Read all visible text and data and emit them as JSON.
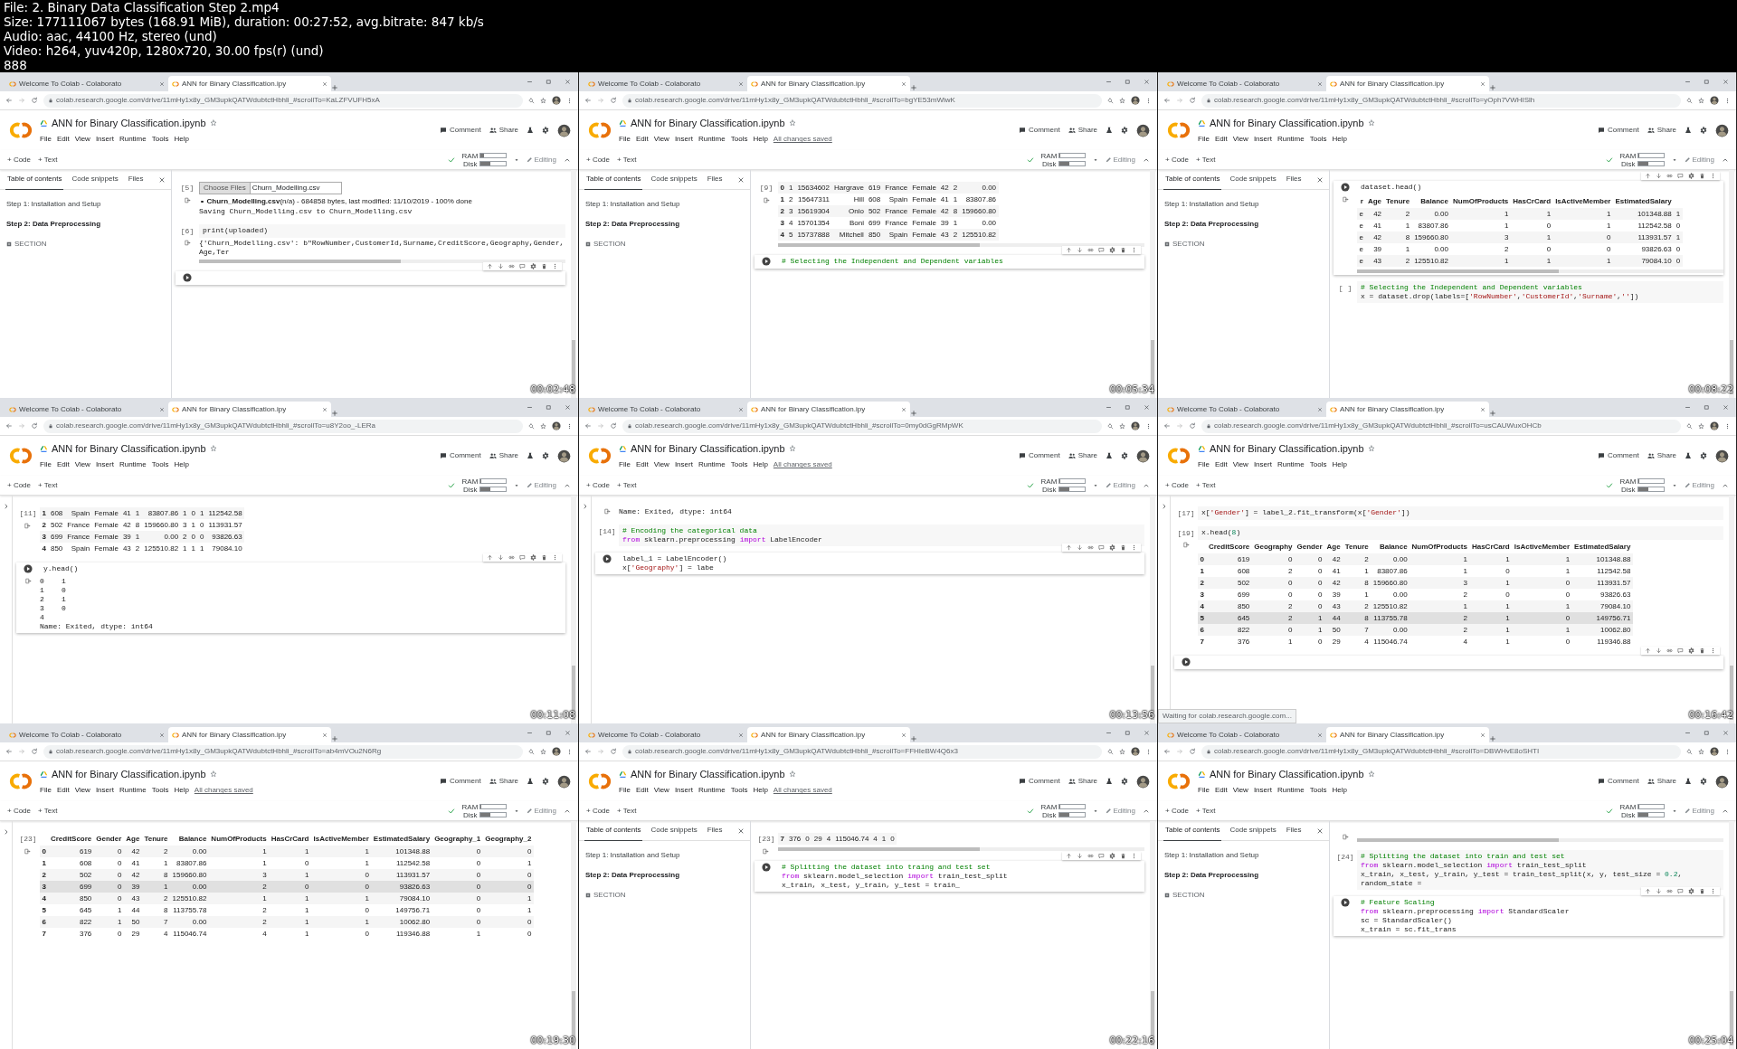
{
  "file_info": [
    "File: 2. Binary Data Classification Step 2.mp4",
    "Size: 177111067 bytes (168.91 MiB), duration: 00:27:52, avg.bitrate: 847 kb/s",
    "Audio: aac, 44100 Hz, stereo (und)",
    "Video: h264, yuv420p, 1280x720, 30.00 fps(r) (und)",
    "888"
  ],
  "frames": [
    {
      "timestamp": "00:02:48",
      "tabs": [
        {
          "title": "Welcome To Colab - Colaborato",
          "selected": false
        },
        {
          "title": "ANN for Binary Classification.ipy",
          "selected": true
        }
      ],
      "url": "colab.research.google.com/drive/11mHy1x8y_GM3upkQATWdubtctHbhli_#scrollTo=KaLZFVUFH5xA",
      "notebook_title": "ANN for Binary Classification.ipynb",
      "menu": [
        "File",
        "Edit",
        "View",
        "Insert",
        "Runtime",
        "Tools",
        "Help"
      ],
      "actions": [
        "Comment",
        "Share"
      ],
      "insert": [
        "+ Code",
        "+ Text"
      ],
      "meters": [
        {
          "label": "RAM",
          "level": 0.15
        },
        {
          "label": "Disk",
          "level": 0.4
        }
      ],
      "mode": "Editing",
      "sidebar": {
        "tabs": [
          {
            "label": "Table of contents",
            "selected": true
          },
          {
            "label": "Code snippets",
            "selected": false
          },
          {
            "label": "Files",
            "selected": false
          }
        ],
        "items": [
          {
            "text": "Step 1: Installation and Setup",
            "selected": false
          },
          {
            "text": "Step 2: Data Preprocessing",
            "selected": true
          }
        ],
        "add_section": "SECTION"
      },
      "cells": [
        {
          "prompt": "[5]",
          "active": false,
          "outputs": [
            {
              "kind": "upload",
              "button": "Choose Files",
              "file": "Churn_Modelling.csv",
              "status": "**Churn_Modelling.csv**(n/a) - 684858 bytes, last modified: 11/10/2019 - 100% done",
              "log": "Saving Churn_Modelling.csv to Churn_Modelling.csv"
            }
          ]
        },
        {
          "prompt": "[6]",
          "active": false,
          "code": [
            "print(uploaded)"
          ],
          "outputs": [
            {
              "kind": "text",
              "lines": [
                "{'Churn_Modelling.csv': b\"RowNumber,CustomerId,Surname,CreditScore,Geography,Gender,Age,Ter"
              ],
              "scrollbar": true
            }
          ]
        },
        {
          "active": true
        }
      ]
    },
    {
      "timestamp": "00:05:34",
      "tabs": [
        {
          "title": "Welcome To Colab - Colaborato",
          "selected": false
        },
        {
          "title": "ANN for Binary Classification.ipy",
          "selected": true
        }
      ],
      "url": "colab.research.google.com/drive/11mHy1x8y_GM3upkQATWdubtctHbhli_#scrollTo=bgYE53mWiwK",
      "notebook_title": "ANN for Binary Classification.ipynb",
      "menu": [
        "File",
        "Edit",
        "View",
        "Insert",
        "Runtime",
        "Tools",
        "Help"
      ],
      "save_status": "All changes saved",
      "actions": [
        "Comment",
        "Share"
      ],
      "insert": [
        "+ Code",
        "+ Text"
      ],
      "meters": [
        {
          "label": "RAM",
          "level": 0.05
        },
        {
          "label": "Disk",
          "level": 0.4
        }
      ],
      "mode": "Editing",
      "sidebar": {
        "tabs": [
          {
            "label": "Table of contents",
            "selected": true
          },
          {
            "label": "Code snippets",
            "selected": false
          },
          {
            "label": "Files",
            "selected": false
          }
        ],
        "items": [
          {
            "text": "Step 1: Installation and Setup",
            "selected": false
          },
          {
            "text": "Step 2: Data Preprocessing",
            "selected": true
          }
        ],
        "add_section": "SECTION"
      },
      "cells": [
        {
          "prompt": "[9]",
          "active": false,
          "outputs": [
            {
              "kind": "table",
              "scrollbar": true,
              "rows": [
                {
                  "index": "0",
                  "cells": [
                    "1",
                    "15634602",
                    "Hargrave",
                    "619",
                    "France",
                    "Female",
                    "42",
                    "2",
                    "0.00"
                  ]
                },
                {
                  "index": "1",
                  "cells": [
                    "2",
                    "15647311",
                    "Hill",
                    "608",
                    "Spain",
                    "Female",
                    "41",
                    "1",
                    "83807.86"
                  ]
                },
                {
                  "index": "2",
                  "cells": [
                    "3",
                    "15619304",
                    "Onio",
                    "502",
                    "France",
                    "Female",
                    "42",
                    "8",
                    "159660.80"
                  ]
                },
                {
                  "index": "3",
                  "cells": [
                    "4",
                    "15701354",
                    "Boni",
                    "699",
                    "France",
                    "Female",
                    "39",
                    "1",
                    "0.00"
                  ]
                },
                {
                  "index": "4",
                  "cells": [
                    "5",
                    "15737888",
                    "Mitchell",
                    "850",
                    "Spain",
                    "Female",
                    "43",
                    "2",
                    "125510.82"
                  ]
                }
              ]
            }
          ]
        },
        {
          "active": true,
          "code": [
            [
              {
                "text": "# Selecting the Independent and Dependent variables",
                "kind": "comment"
              }
            ]
          ]
        }
      ]
    },
    {
      "timestamp": "00:08:22",
      "tabs": [
        {
          "title": "Welcome To Colab - Colaborato",
          "selected": false
        },
        {
          "title": "ANN for Binary Classification.ipy",
          "selected": true
        }
      ],
      "url": "colab.research.google.com/drive/11mHy1x8y_GM3upkQATWdubtctHbhli_#scrollTo=yOph7VWHISlh",
      "notebook_title": "ANN for Binary Classification.ipynb",
      "menu": [
        "File",
        "Edit",
        "View",
        "Insert",
        "Runtime",
        "Tools",
        "Help"
      ],
      "actions": [
        "Comment",
        "Share"
      ],
      "insert": [
        "+ Code",
        "+ Text"
      ],
      "meters": [
        {
          "label": "RAM",
          "level": 0.05
        },
        {
          "label": "Disk",
          "level": 0.4
        }
      ],
      "mode": "Editing",
      "sidebar": {
        "tabs": [
          {
            "label": "Table of contents",
            "selected": true
          },
          {
            "label": "Code snippets",
            "selected": false
          },
          {
            "label": "Files",
            "selected": false
          }
        ],
        "items": [
          {
            "text": "Step 1: Installation and Setup",
            "selected": false
          },
          {
            "text": "Step 2: Data Preprocessing",
            "selected": true
          }
        ],
        "add_section": "SECTION"
      },
      "cells": [
        {
          "active": true,
          "code": [
            "dataset.head()"
          ],
          "outputs": [
            {
              "kind": "table",
              "scrollbar": true,
              "columns": [
                "r",
                "Age",
                "Tenure",
                "Balance",
                "NumOfProducts",
                "HasCrCard",
                "IsActiveMember",
                "EstimatedSalary"
              ],
              "rows": [
                {
                  "cells": [
                    "e",
                    "42",
                    "2",
                    "0.00",
                    "1",
                    "1",
                    "1",
                    "101348.88",
                    "1"
                  ]
                },
                {
                  "cells": [
                    "e",
                    "41",
                    "1",
                    "83807.86",
                    "1",
                    "0",
                    "1",
                    "112542.58",
                    "0"
                  ]
                },
                {
                  "cells": [
                    "e",
                    "42",
                    "8",
                    "159660.80",
                    "3",
                    "1",
                    "0",
                    "113931.57",
                    "1"
                  ]
                },
                {
                  "cells": [
                    "e",
                    "39",
                    "1",
                    "0.00",
                    "2",
                    "0",
                    "0",
                    "93826.63",
                    "0"
                  ]
                },
                {
                  "cells": [
                    "e",
                    "43",
                    "2",
                    "125510.82",
                    "1",
                    "1",
                    "1",
                    "79084.10",
                    "0"
                  ]
                }
              ]
            }
          ]
        },
        {
          "prompt": "[ ]",
          "active": false,
          "code": [
            [
              {
                "text": "# Selecting the Independent and Dependent variables",
                "kind": "comment"
              }
            ],
            [
              {
                "text": "x = dataset.drop(labels=[",
                "kind": "plain"
              },
              {
                "text": "'RowNumber'",
                "kind": "string"
              },
              {
                "text": ",",
                "kind": "plain"
              },
              {
                "text": "'CustomerId'",
                "kind": "string"
              },
              {
                "text": ",",
                "kind": "plain"
              },
              {
                "text": "'Surname'",
                "kind": "string"
              },
              {
                "text": ",",
                "kind": "plain"
              },
              {
                "text": "''",
                "kind": "string"
              },
              {
                "text": "])",
                "kind": "plain"
              }
            ]
          ]
        }
      ]
    },
    {
      "timestamp": "00:11:08",
      "tabs": [
        {
          "title": "Welcome To Colab - Colaborato",
          "selected": false
        },
        {
          "title": "ANN for Binary Classification.ipy",
          "selected": true
        }
      ],
      "url": "colab.research.google.com/drive/11mHy1x8y_GM3upkQATWdubtctHbhli_#scrollTo=u8Y2oo_-LERa",
      "notebook_title": "ANN for Binary Classification.ipynb",
      "menu": [
        "File",
        "Edit",
        "View",
        "Insert",
        "Runtime",
        "Tools",
        "Help"
      ],
      "actions": [
        "Comment",
        "Share"
      ],
      "insert": [
        "+ Code",
        "+ Text"
      ],
      "meters": [
        {
          "label": "RAM",
          "level": 0.05
        },
        {
          "label": "Disk",
          "level": 0.4
        }
      ],
      "mode": "Editing",
      "cells": [
        {
          "prompt": "[11]",
          "active": false,
          "outputs": [
            {
              "kind": "table",
              "rows": [
                {
                  "index": "1",
                  "cells": [
                    "608",
                    "Spain",
                    "Female",
                    "41",
                    "1",
                    "83807.86",
                    "1",
                    "0",
                    "1",
                    "112542.58"
                  ]
                },
                {
                  "index": "2",
                  "cells": [
                    "502",
                    "France",
                    "Female",
                    "42",
                    "8",
                    "159660.80",
                    "3",
                    "1",
                    "0",
                    "113931.57"
                  ]
                },
                {
                  "index": "3",
                  "cells": [
                    "699",
                    "France",
                    "Female",
                    "39",
                    "1",
                    "0.00",
                    "2",
                    "0",
                    "0",
                    "93826.63"
                  ]
                },
                {
                  "index": "4",
                  "cells": [
                    "850",
                    "Spain",
                    "Female",
                    "43",
                    "2",
                    "125510.82",
                    "1",
                    "1",
                    "1",
                    "79084.10"
                  ]
                }
              ]
            }
          ]
        },
        {
          "active": true,
          "code": [
            "y.head()"
          ],
          "outputs": [
            {
              "kind": "text",
              "lines": [
                "0    1",
                "1    0",
                "2    1",
                "3    0",
                "4",
                "Name: Exited, dtype: int64"
              ]
            }
          ]
        }
      ]
    },
    {
      "timestamp": "00:13:56",
      "tabs": [
        {
          "title": "Welcome To Colab - Colaborato",
          "selected": false
        },
        {
          "title": "ANN for Binary Classification.ipy",
          "selected": true
        }
      ],
      "url": "colab.research.google.com/drive/11mHy1x8y_GM3upkQATWdubtctHbhli_#scrollTo=0my0dGgRMpWK",
      "notebook_title": "ANN for Binary Classification.ipynb",
      "menu": [
        "File",
        "Edit",
        "View",
        "Insert",
        "Runtime",
        "Tools",
        "Help"
      ],
      "save_status": "All changes saved",
      "actions": [
        "Comment",
        "Share"
      ],
      "insert": [
        "+ Code",
        "+ Text"
      ],
      "meters": [
        {
          "label": "RAM",
          "level": 0.05
        },
        {
          "label": "Disk",
          "level": 0.4
        }
      ],
      "mode": "Editing",
      "cells": [
        {
          "active": false,
          "outputs": [
            {
              "kind": "text",
              "lines": [
                "Name: Exited, dtype: int64"
              ]
            }
          ]
        },
        {
          "prompt": "[14]",
          "active": false,
          "code": [
            [
              {
                "text": "# Encoding the categorical data",
                "kind": "comment"
              }
            ],
            [
              {
                "text": "from",
                "kind": "keyword"
              },
              {
                "text": " sklearn.preprocessing ",
                "kind": "plain"
              },
              {
                "text": "import",
                "kind": "keyword"
              },
              {
                "text": " LabelEncoder",
                "kind": "plain"
              }
            ]
          ]
        },
        {
          "active": true,
          "code": [
            "label_1 = LabelEncoder()",
            [
              {
                "text": "x[",
                "kind": "plain"
              },
              {
                "text": "'Geography'",
                "kind": "string"
              },
              {
                "text": "] = labe",
                "kind": "plain"
              }
            ]
          ]
        }
      ]
    },
    {
      "timestamp": "00:16:42",
      "tabs": [
        {
          "title": "Welcome To Colab - Colaborato",
          "selected": false
        },
        {
          "title": "ANN for Binary Classification.ipy",
          "selected": true
        }
      ],
      "url": "colab.research.google.com/drive/11mHy1x8y_GM3upkQATWdubtctHbhli_#scrollTo=usCAUWuxOHCb",
      "notebook_title": "ANN for Binary Classification.ipynb",
      "menu": [
        "File",
        "Edit",
        "View",
        "Insert",
        "Runtime",
        "Tools",
        "Help"
      ],
      "actions": [
        "Comment",
        "Share"
      ],
      "insert": [
        "+ Code",
        "+ Text"
      ],
      "meters": [
        {
          "label": "RAM",
          "level": 0.05
        },
        {
          "label": "Disk",
          "level": 0.4
        }
      ],
      "mode": "Editing",
      "status_text": "Waiting for colab.research.google.com...",
      "cells": [
        {
          "prompt": "[17]",
          "active": false,
          "code": [
            [
              {
                "text": "x[",
                "kind": "plain"
              },
              {
                "text": "'Gender'",
                "kind": "string"
              },
              {
                "text": "] = label_2.fit_transform(x[",
                "kind": "plain"
              },
              {
                "text": "'Gender'",
                "kind": "string"
              },
              {
                "text": "])",
                "kind": "plain"
              }
            ]
          ]
        },
        {
          "prompt": "[19]",
          "active": false,
          "code": [
            [
              {
                "text": "x.head(",
                "kind": "plain"
              },
              {
                "text": "8",
                "kind": "number"
              },
              {
                "text": ")",
                "kind": "plain"
              }
            ]
          ],
          "outputs": [
            {
              "kind": "table",
              "columns": [
                "CreditScore",
                "Geography",
                "Gender",
                "Age",
                "Tenure",
                "Balance",
                "NumOfProducts",
                "HasCrCard",
                "IsActiveMember",
                "EstimatedSalary"
              ],
              "rows": [
                {
                  "index": "0",
                  "hovered": false,
                  "cells": [
                    "619",
                    "0",
                    "0",
                    "42",
                    "2",
                    "0.00",
                    "1",
                    "1",
                    "1",
                    "101348.88"
                  ]
                },
                {
                  "index": "1",
                  "hovered": false,
                  "cells": [
                    "608",
                    "2",
                    "0",
                    "41",
                    "1",
                    "83807.86",
                    "1",
                    "0",
                    "1",
                    "112542.58"
                  ]
                },
                {
                  "index": "2",
                  "hovered": false,
                  "cells": [
                    "502",
                    "0",
                    "0",
                    "42",
                    "8",
                    "159660.80",
                    "3",
                    "1",
                    "0",
                    "113931.57"
                  ]
                },
                {
                  "index": "3",
                  "hovered": false,
                  "cells": [
                    "699",
                    "0",
                    "0",
                    "39",
                    "1",
                    "0.00",
                    "2",
                    "0",
                    "0",
                    "93826.63"
                  ]
                },
                {
                  "index": "4",
                  "hovered": false,
                  "cells": [
                    "850",
                    "2",
                    "0",
                    "43",
                    "2",
                    "125510.82",
                    "1",
                    "1",
                    "1",
                    "79084.10"
                  ]
                },
                {
                  "index": "5",
                  "hovered": true,
                  "cells": [
                    "645",
                    "2",
                    "1",
                    "44",
                    "8",
                    "113755.78",
                    "2",
                    "1",
                    "0",
                    "149756.71"
                  ]
                },
                {
                  "index": "6",
                  "hovered": false,
                  "cells": [
                    "822",
                    "0",
                    "1",
                    "50",
                    "7",
                    "0.00",
                    "2",
                    "1",
                    "1",
                    "10062.80"
                  ]
                },
                {
                  "index": "7",
                  "hovered": false,
                  "cells": [
                    "376",
                    "1",
                    "0",
                    "29",
                    "4",
                    "115046.74",
                    "4",
                    "1",
                    "0",
                    "119346.88"
                  ]
                }
              ]
            }
          ]
        },
        {
          "active": true
        }
      ]
    },
    {
      "timestamp": "00:19:30",
      "tabs": [
        {
          "title": "Welcome To Colab - Colaborato",
          "selected": false
        },
        {
          "title": "ANN for Binary Classification.ipy",
          "selected": true
        }
      ],
      "url": "colab.research.google.com/drive/11mHy1x8y_GM3upkQATWdubtctHbhli_#scrollTo=ab4mVOu2N6Rg",
      "notebook_title": "ANN for Binary Classification.ipynb",
      "menu": [
        "File",
        "Edit",
        "View",
        "Insert",
        "Runtime",
        "Tools",
        "Help"
      ],
      "save_status": "All changes saved",
      "actions": [
        "Comment",
        "Share"
      ],
      "insert": [
        "+ Code",
        "+ Text"
      ],
      "meters": [
        {
          "label": "RAM",
          "level": 0.05
        },
        {
          "label": "Disk",
          "level": 0.4
        }
      ],
      "mode": "Editing",
      "cells": [
        {
          "prompt": "[23]",
          "active": false,
          "outputs": [
            {
              "kind": "table",
              "columns": [
                "CreditScore",
                "Gender",
                "Age",
                "Tenure",
                "Balance",
                "NumOfProducts",
                "HasCrCard",
                "IsActiveMember",
                "EstimatedSalary",
                "Geography_1",
                "Geography_2"
              ],
              "rows": [
                {
                  "index": "0",
                  "hovered": false,
                  "cells": [
                    "619",
                    "0",
                    "42",
                    "2",
                    "0.00",
                    "1",
                    "1",
                    "1",
                    "101348.88",
                    "0",
                    "0"
                  ]
                },
                {
                  "index": "1",
                  "hovered": false,
                  "cells": [
                    "608",
                    "0",
                    "41",
                    "1",
                    "83807.86",
                    "1",
                    "0",
                    "1",
                    "112542.58",
                    "0",
                    "1"
                  ]
                },
                {
                  "index": "2",
                  "hovered": false,
                  "cells": [
                    "502",
                    "0",
                    "42",
                    "8",
                    "159660.80",
                    "3",
                    "1",
                    "0",
                    "113931.57",
                    "0",
                    "0"
                  ]
                },
                {
                  "index": "3",
                  "hovered": true,
                  "cells": [
                    "699",
                    "0",
                    "39",
                    "1",
                    "0.00",
                    "2",
                    "0",
                    "0",
                    "93826.63",
                    "0",
                    "0"
                  ]
                },
                {
                  "index": "4",
                  "hovered": false,
                  "cells": [
                    "850",
                    "0",
                    "43",
                    "2",
                    "125510.82",
                    "1",
                    "1",
                    "1",
                    "79084.10",
                    "0",
                    "1"
                  ]
                },
                {
                  "index": "5",
                  "hovered": false,
                  "cells": [
                    "645",
                    "1",
                    "44",
                    "8",
                    "113755.78",
                    "2",
                    "1",
                    "0",
                    "149756.71",
                    "0",
                    "1"
                  ]
                },
                {
                  "index": "6",
                  "hovered": false,
                  "cells": [
                    "822",
                    "1",
                    "50",
                    "7",
                    "0.00",
                    "2",
                    "1",
                    "1",
                    "10062.80",
                    "0",
                    "0"
                  ]
                },
                {
                  "index": "7",
                  "hovered": false,
                  "cells": [
                    "376",
                    "0",
                    "29",
                    "4",
                    "115046.74",
                    "4",
                    "1",
                    "0",
                    "119346.88",
                    "1",
                    "0"
                  ]
                }
              ]
            }
          ]
        }
      ]
    },
    {
      "timestamp": "00:22:16",
      "tabs": [
        {
          "title": "Welcome To Colab - Colaborato",
          "selected": false
        },
        {
          "title": "ANN for Binary Classification.ipy",
          "selected": true
        }
      ],
      "url": "colab.research.google.com/drive/11mHy1x8y_GM3upkQATWdubtctHbhli_#scrollTo=FFHIeBW4Q6x3",
      "notebook_title": "ANN for Binary Classification.ipynb",
      "menu": [
        "File",
        "Edit",
        "View",
        "Insert",
        "Runtime",
        "Tools",
        "Help"
      ],
      "save_status": "All changes saved",
      "actions": [
        "Comment",
        "Share"
      ],
      "insert": [
        "+ Code",
        "+ Text"
      ],
      "meters": [
        {
          "label": "RAM",
          "level": 0.05
        },
        {
          "label": "Disk",
          "level": 0.4
        }
      ],
      "mode": "Editing",
      "sidebar": {
        "tabs": [
          {
            "label": "Table of contents",
            "selected": true
          },
          {
            "label": "Code snippets",
            "selected": false
          },
          {
            "label": "Files",
            "selected": false
          }
        ],
        "items": [
          {
            "text": "Step 1: Installation and Setup",
            "selected": false
          },
          {
            "text": "Step 2: Data Preprocessing",
            "selected": true
          }
        ],
        "add_section": "SECTION"
      },
      "cells": [
        {
          "prompt": "[23]",
          "active": false,
          "outputs": [
            {
              "kind": "table",
              "scrollbar": true,
              "rows": [
                {
                  "index": "7",
                  "cells": [
                    "376",
                    "0",
                    "29",
                    "4",
                    "115046.74",
                    "4",
                    "1",
                    "0"
                  ]
                }
              ]
            }
          ]
        },
        {
          "active": true,
          "code": [
            [
              {
                "text": "# Splitting the dataset into traing and test set",
                "kind": "comment"
              }
            ],
            [
              {
                "text": "from",
                "kind": "keyword"
              },
              {
                "text": " sklearn.model_selection ",
                "kind": "plain"
              },
              {
                "text": "import",
                "kind": "keyword"
              },
              {
                "text": " train_test_split",
                "kind": "plain"
              }
            ],
            "x_train, x_test, y_train, y_test = train_"
          ]
        }
      ]
    },
    {
      "timestamp": "00:25:04",
      "tabs": [
        {
          "title": "Welcome To Colab - Colaborato",
          "selected": false
        },
        {
          "title": "ANN for Binary Classification.ipy",
          "selected": true
        }
      ],
      "url": "colab.research.google.com/drive/11mHy1x8y_GM3upkQATWdubtctHbhli_#scrollTo=DBWHvE8oSHTI",
      "notebook_title": "ANN for Binary Classification.ipynb",
      "menu": [
        "File",
        "Edit",
        "View",
        "Insert",
        "Runtime",
        "Tools",
        "Help"
      ],
      "actions": [
        "Comment",
        "Share"
      ],
      "insert": [
        "+ Code",
        "+ Text"
      ],
      "meters": [
        {
          "label": "RAM",
          "level": 0.05
        },
        {
          "label": "Disk",
          "level": 0.4
        }
      ],
      "mode": "Editing",
      "sidebar": {
        "tabs": [
          {
            "label": "Table of contents",
            "selected": true
          },
          {
            "label": "Code snippets",
            "selected": false
          },
          {
            "label": "Files",
            "selected": false
          }
        ],
        "items": [
          {
            "text": "Step 1: Installation and Setup",
            "selected": false
          },
          {
            "text": "Step 2: Data Preprocessing",
            "selected": true
          }
        ],
        "add_section": "SECTION"
      },
      "cells": [
        {
          "active": false,
          "outputs": [
            {
              "kind": "scrolled"
            }
          ]
        },
        {
          "prompt": "[24]",
          "active": false,
          "code": [
            [
              {
                "text": "# Splitting the dataset into train and test set",
                "kind": "comment"
              }
            ],
            [
              {
                "text": "from",
                "kind": "keyword"
              },
              {
                "text": " sklearn.model_selection ",
                "kind": "plain"
              },
              {
                "text": "import",
                "kind": "keyword"
              },
              {
                "text": " train_test_split",
                "kind": "plain"
              }
            ],
            [
              {
                "text": "x_train, x_test, y_train, y_test = train_test_split(x, y, test_size = ",
                "kind": "plain"
              },
              {
                "text": "0.2",
                "kind": "number"
              },
              {
                "text": ", random_state =",
                "kind": "plain"
              }
            ]
          ]
        },
        {
          "active": true,
          "code": [
            [
              {
                "text": "# Feature Scaling",
                "kind": "comment"
              }
            ],
            [
              {
                "text": "from",
                "kind": "keyword"
              },
              {
                "text": " sklearn.preprocessing ",
                "kind": "plain"
              },
              {
                "text": "import",
                "kind": "keyword"
              },
              {
                "text": " StandardScaler",
                "kind": "plain"
              }
            ],
            "sc = StandardScaler()",
            "x_train = sc.fit_trans"
          ]
        }
      ]
    }
  ]
}
